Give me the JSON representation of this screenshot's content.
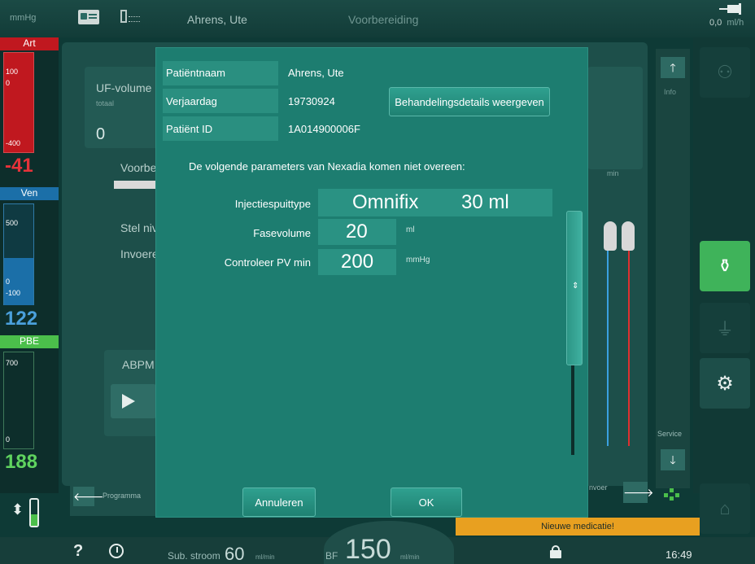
{
  "topbar": {
    "unit": "mmHg",
    "patient_name": "Ahrens, Ute",
    "phase": "Voorbereiding",
    "flow_value": "0,0",
    "flow_unit": "ml/h"
  },
  "left": {
    "art_label": "Art",
    "art_scale_top": "100",
    "art_scale_mid": "0",
    "art_scale_bottom": "-400",
    "art_value": "-41",
    "ven_label": "Ven",
    "ven_scale_top": "500",
    "ven_scale_mid": "0",
    "ven_scale_bottom": "-100",
    "ven_value": "122",
    "pbe_label": "PBE",
    "pbe_scale_top": "700",
    "pbe_scale_bottom": "0",
    "pbe_value": "188"
  },
  "background": {
    "uf_volume": "UF-volume",
    "uf_total": "totaal",
    "uf_value": "0",
    "voorbere": "Voorbere",
    "stel_nive": "Stel nive",
    "invoeren": "Invoeren",
    "abpm": "ABPM",
    "min": "min",
    "programma": "Programma",
    "invoer": "nvoer",
    "info": "Info",
    "service": "Service"
  },
  "modal": {
    "patient_name_label": "Patiëntnaam",
    "patient_name_value": "Ahrens, Ute",
    "birthday_label": "Verjaardag",
    "birthday_value": "19730924",
    "patient_id_label": "Patiënt ID",
    "patient_id_value": "1A014900006F",
    "details_button": "Behandelingsdetails weergeven",
    "message": "De volgende parameters van Nexadia komen niet overeen:",
    "params": [
      {
        "label": "Injectiespuittype",
        "value": "Omnifix",
        "value2": "30 ml",
        "unit": ""
      },
      {
        "label": "Fasevolume",
        "value": "20",
        "value2": "",
        "unit": "ml"
      },
      {
        "label": "Controleer PV min",
        "value": "200",
        "value2": "",
        "unit": "mmHg"
      }
    ],
    "cancel_button": "Annuleren",
    "ok_button": "OK"
  },
  "notification": "Nieuwe medicatie!",
  "bottombar": {
    "sub_label": "Sub. stroom",
    "sub_value": "60",
    "sub_unit": "ml/min",
    "bf_label": "BF",
    "bf_value": "150",
    "bf_unit": "ml/min",
    "time": "16:49"
  },
  "colors": {
    "modal_bg": "#1d7d70",
    "art_red": "#c0181f",
    "ven_blue": "#1b6fa8",
    "pbe_green": "#4bbf4b",
    "notification": "#e8a020"
  }
}
